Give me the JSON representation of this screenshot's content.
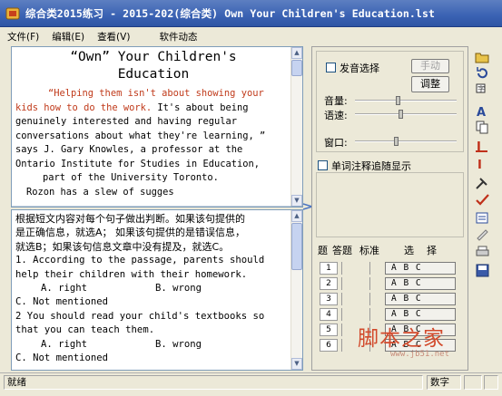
{
  "window": {
    "title": "综合类2015练习 - 2015-202(综合类) Own Your Children's Education.lst"
  },
  "menu": {
    "items": [
      "文件(F)",
      "编辑(E)",
      "查看(V)"
    ],
    "extra": "软件动态"
  },
  "passage": {
    "title_line1": "“Own” Your Children's",
    "title_line2": "Education",
    "red_line1": "“Helping them isn't about showing your",
    "red_line2": "kids how to do the work.",
    "rest_line2": " It's about being",
    "lines": [
      "genuinely interested and having regular",
      "conversations about what they're learning, ”",
      "says J. Gary Knowles, a professor at the",
      "Ontario Institute for Studies in Education,",
      "part of the University Toronto.",
      "Rozon has a slew of sugges"
    ]
  },
  "questions": {
    "instructions": [
      "根据短文内容对每个句子做出判断。如果该句提供的",
      "是正确信息，就选A； 如果该句提供的是错误信息，",
      "就选B；如果该句信息文章中没有提及，就选C。"
    ],
    "items": [
      {
        "stem_line1": "1.  According to the passage, parents should",
        "stem_line2": "help their children with their homework.",
        "opt_a": "A. right",
        "opt_b": "B. wrong",
        "opt_c": "C. Not mentioned"
      },
      {
        "stem_line1": "2  You should read your child's textbooks so",
        "stem_line2": "that you can teach them.",
        "opt_a": "A. right",
        "opt_b": "B. wrong",
        "opt_c": "C. Not mentioned"
      }
    ]
  },
  "controls": {
    "voice_select_label": "发音选择",
    "manual_button": "手动",
    "adjust_button": "调整",
    "volume_label": "音量:",
    "speed_label": "语速:",
    "window_label": "窗口:",
    "volume_level": 0.42,
    "speed_level": 0.45,
    "window_level": 0.4,
    "follow_label": "单词注释追随显示"
  },
  "answer_sheet": {
    "headers": [
      "题",
      "答题",
      "标准",
      "选    择"
    ],
    "rows": [
      {
        "num": "1",
        "choices": "A B C"
      },
      {
        "num": "2",
        "choices": "A B C"
      },
      {
        "num": "3",
        "choices": "A B C"
      },
      {
        "num": "4",
        "choices": "A B C"
      },
      {
        "num": "5",
        "choices": "A B C"
      },
      {
        "num": "6",
        "choices": "A B C"
      }
    ]
  },
  "status": {
    "left": "就绪",
    "mode": "数字"
  },
  "watermark": {
    "text": "脚本之家",
    "url": "www.jb51.net"
  }
}
